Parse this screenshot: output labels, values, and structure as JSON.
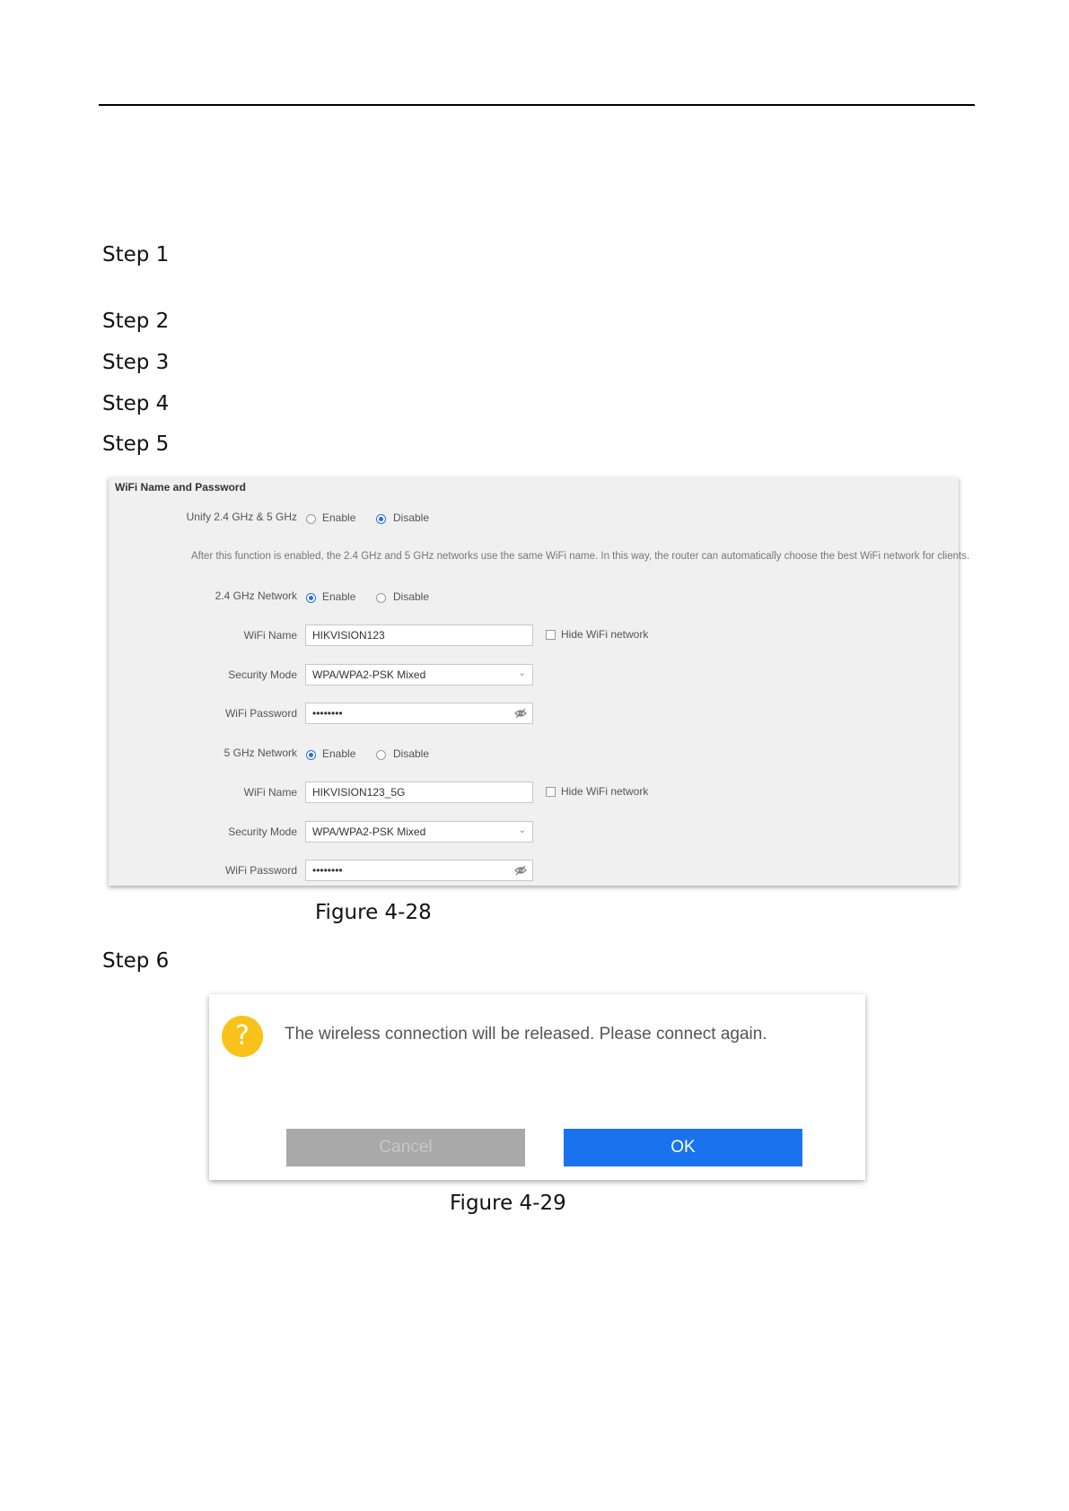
{
  "steps": [
    "Step 1",
    "Step 2",
    "Step 3",
    "Step 4",
    "Step 5",
    "Step 6"
  ],
  "figure28": {
    "caption": "Figure 4-28",
    "title": "WiFi Name and Password",
    "unify_label": "Unify 2.4 GHz & 5 GHz",
    "enable": "Enable",
    "disable": "Disable",
    "note": "After this function is enabled, the 2.4 GHz and 5 GHz networks use the same WiFi name. In this way, the router can automatically choose the best WiFi network for clients.",
    "net24_label": "2.4 GHz Network",
    "net5_label": "5 GHz Network",
    "wifi_name_label": "WiFi Name",
    "security_mode_label": "Security Mode",
    "wifi_password_label": "WiFi Password",
    "hide_label": "Hide WiFi network",
    "net24": {
      "name": "HIKVISION123",
      "security": "WPA/WPA2-PSK Mixed",
      "password": "••••••••"
    },
    "net5": {
      "name": "HIKVISION123_5G",
      "security": "WPA/WPA2-PSK Mixed",
      "password": "••••••••"
    }
  },
  "figure29": {
    "caption": "Figure 4-29",
    "icon": "question-icon",
    "icon_glyph": "?",
    "message": "The wireless connection will be released. Please connect again.",
    "cancel": "Cancel",
    "ok": "OK"
  }
}
